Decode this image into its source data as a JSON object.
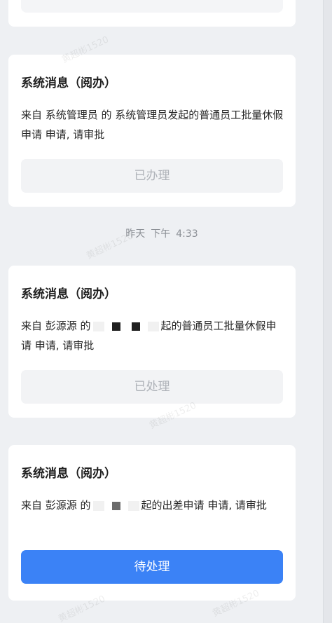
{
  "watermark_text": "黄超彬1520",
  "timestamp": {
    "day": "昨天",
    "period": "下午",
    "time": "4:33"
  },
  "messages": [
    {
      "title": "系统消息（阅办）",
      "body": "来自 系统管理员 的 系统管理员发起的普通员工批量休假申请 申请, 请审批",
      "button": "已办理",
      "status": "done"
    },
    {
      "title": "系统消息（阅办）",
      "body_prefix": "来自 彭源源 的",
      "body_suffix": "起的普通员工批量休假申请 申请, 请审批",
      "button": "已处理",
      "status": "done"
    },
    {
      "title": "系统消息（阅办）",
      "body_prefix": "来自 彭源源 的",
      "body_suffix": "起的出差申请 申请, 请审批",
      "button": "待处理",
      "status": "pending"
    }
  ],
  "colors": {
    "background": "#eef0f3",
    "card": "#ffffff",
    "primary_button": "#3b82f6",
    "disabled_button": "#f2f3f5",
    "disabled_text": "#aeb2b8",
    "timestamp_text": "#8c9096"
  }
}
